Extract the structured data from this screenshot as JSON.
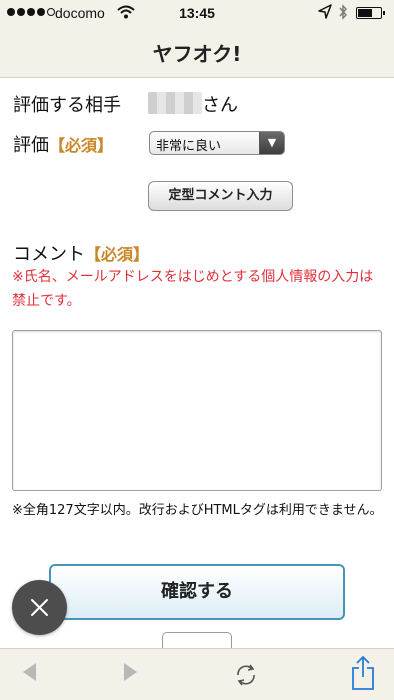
{
  "status_bar": {
    "carrier": "docomo",
    "time": "13:45",
    "wifi_icon": "wifi-icon",
    "location_icon": "location-arrow-icon",
    "bluetooth_icon": "bluetooth-icon",
    "battery_icon": "battery-icon"
  },
  "header": {
    "title": "ヤフオク!"
  },
  "form": {
    "partner_label": "評価する相手",
    "partner_suffix": "さん",
    "rating_label": "評価",
    "rating_required": "【必須】",
    "rating_select_value": "非常に良い",
    "template_button_label": "定型コメント入力",
    "comment_label": "コメント",
    "comment_required": "【必須】",
    "warning": "※氏名、メールアドレスをはじめとする個人情報の入力は禁止です。",
    "comment_value": "",
    "note": "※全角127文字以内。改行およびHTMLタグは利用できません。",
    "confirm_button_label": "確認する"
  },
  "colors": {
    "required": "#c98728",
    "warning": "#e0303a",
    "confirm_border": "#4a93b8",
    "bar_background": "#f4f1e8"
  },
  "toolbar": {
    "back_icon": "back-arrow-icon",
    "forward_icon": "forward-arrow-icon",
    "reload_icon": "reload-icon",
    "share_icon": "share-icon"
  },
  "overlay": {
    "close_icon": "close-icon"
  }
}
